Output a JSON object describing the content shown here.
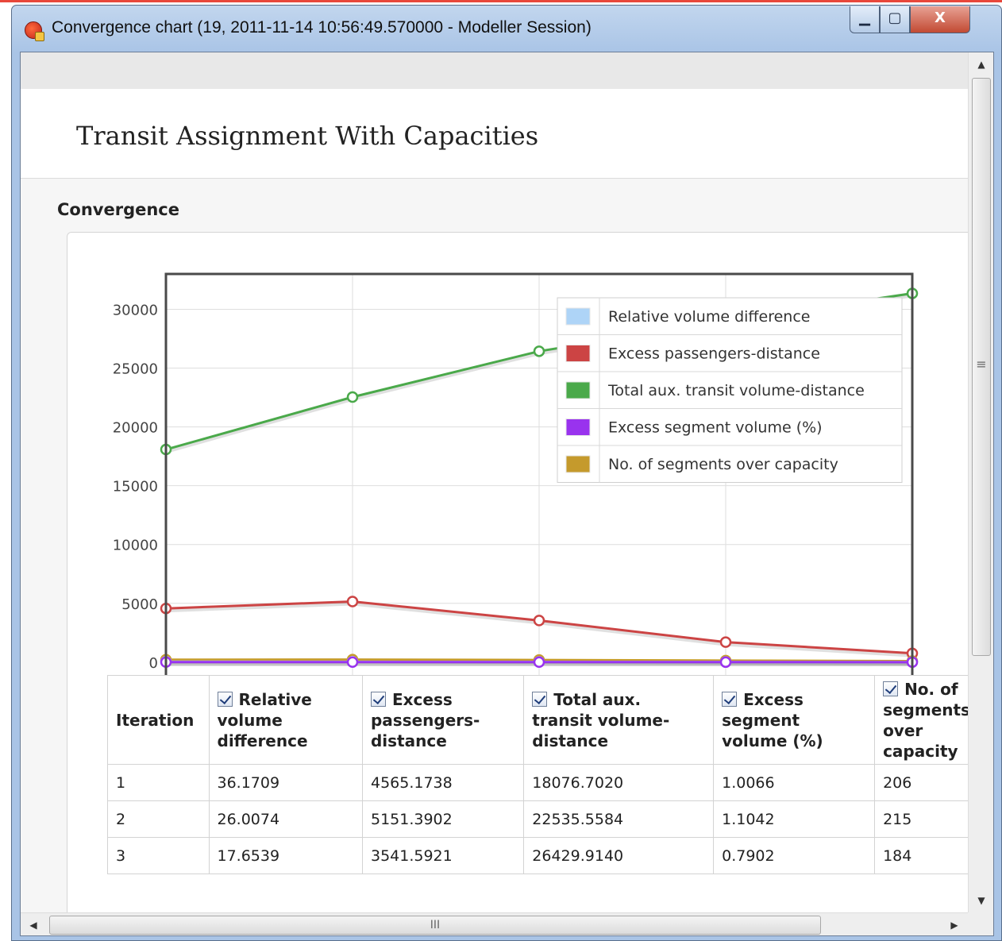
{
  "window": {
    "title": "Convergence chart (19, 2011-11-14 10:56:49.570000 - Modeller Session)",
    "minimize_icon": "minimize-icon",
    "maximize_icon": "maximize-icon",
    "close_icon": "close-icon",
    "minimize_glyph": "▁",
    "maximize_glyph": "▢",
    "close_glyph": "X"
  },
  "report": {
    "title": "Transit Assignment With Capacities",
    "section_title": "Convergence"
  },
  "chart_data": {
    "type": "line",
    "x": [
      1,
      2,
      3,
      4,
      5
    ],
    "xlabel": "",
    "ylabel": "",
    "xlim": [
      1,
      5
    ],
    "ylim": [
      -1700,
      33000
    ],
    "yticks": [
      0,
      5000,
      10000,
      15000,
      20000,
      25000,
      30000
    ],
    "grid": true,
    "legend_position": "top-right",
    "series": [
      {
        "name": "Relative volume difference",
        "color": "#aed4f7",
        "values": [
          36.1709,
          26.0074,
          17.6539,
          10,
          5
        ]
      },
      {
        "name": "Excess passengers-distance",
        "color": "#cc4444",
        "values": [
          4565.1738,
          5151.3902,
          3541.5921,
          1700,
          750
        ]
      },
      {
        "name": "Total aux. transit volume-distance",
        "color": "#4aa94a",
        "values": [
          18076.702,
          22535.5584,
          26429.914,
          29000,
          31350
        ]
      },
      {
        "name": "Excess segment volume (%)",
        "color": "#9933ee",
        "values": [
          1.0066,
          1.1042,
          0.7902,
          0.5,
          0.3
        ]
      },
      {
        "name": "No. of segments over capacity",
        "color": "#c59a2c",
        "values": [
          206,
          215,
          184,
          130,
          90
        ]
      }
    ]
  },
  "table": {
    "iteration_header": "Iteration",
    "headers": [
      "Relative volume difference",
      "Excess passengers-distance",
      "Total aux. transit volume-distance",
      "Excess segment volume (%)",
      "No. of segments over capacity"
    ],
    "rows": [
      [
        "1",
        "36.1709",
        "4565.1738",
        "18076.7020",
        "1.0066",
        "206"
      ],
      [
        "2",
        "26.0074",
        "5151.3902",
        "22535.5584",
        "1.1042",
        "215"
      ],
      [
        "3",
        "17.6539",
        "3541.5921",
        "26429.9140",
        "0.7902",
        "184"
      ]
    ]
  },
  "scrollbars": {
    "up_glyph": "▲",
    "down_glyph": "▼",
    "left_glyph": "◀",
    "right_glyph": "▶",
    "vertical_grip": "≡",
    "horizontal_grip": "III"
  }
}
